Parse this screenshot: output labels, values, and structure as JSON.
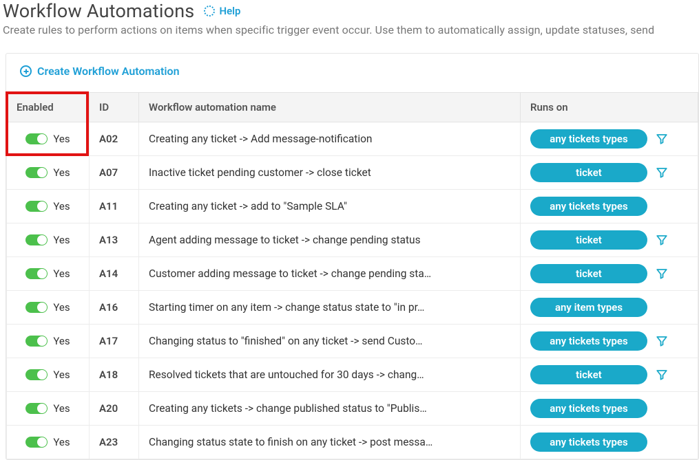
{
  "header": {
    "title": "Workflow Automations",
    "help_label": "Help",
    "subtitle": "Create rules to perform actions on items when specific trigger event occur. Use them to automatically assign, update statuses, send"
  },
  "create_link": "Create Workflow Automation",
  "columns": {
    "enabled": "Enabled",
    "id": "ID",
    "name": "Workflow automation name",
    "runs_on": "Runs on"
  },
  "enabled_label": "Yes",
  "colors": {
    "accent": "#1e9fd6",
    "pill": "#1aa9c9",
    "toggle_on": "#4cc04c",
    "highlight": "#e11313"
  },
  "rows": [
    {
      "id": "A02",
      "name": "Creating any ticket -> Add message-notification",
      "runs_on": "any tickets types",
      "has_filter": true
    },
    {
      "id": "A07",
      "name": "Inactive ticket pending customer -> close ticket",
      "runs_on": "ticket",
      "has_filter": true
    },
    {
      "id": "A11",
      "name": "Creating any ticket -> add to \"Sample SLA\"",
      "runs_on": "any tickets types",
      "has_filter": false
    },
    {
      "id": "A13",
      "name": "Agent adding message to ticket -> change pending status",
      "runs_on": "ticket",
      "has_filter": true
    },
    {
      "id": "A14",
      "name": "Customer adding message to ticket -> change pending sta…",
      "runs_on": "ticket",
      "has_filter": true
    },
    {
      "id": "A16",
      "name": "Starting timer on any item -> change status state to \"in pr…",
      "runs_on": "any item types",
      "has_filter": false
    },
    {
      "id": "A17",
      "name": "Changing status to \"finished\" on any ticket -> send Custo…",
      "runs_on": "any tickets types",
      "has_filter": true
    },
    {
      "id": "A18",
      "name": "Resolved tickets that are untouched for 30 days -> chang…",
      "runs_on": "ticket",
      "has_filter": true
    },
    {
      "id": "A20",
      "name": "Creating any tickets -> change published status to \"Publis…",
      "runs_on": "any tickets types",
      "has_filter": false
    },
    {
      "id": "A23",
      "name": "Changing status state to finish on any ticket -> post messa…",
      "runs_on": "any tickets types",
      "has_filter": false
    }
  ]
}
